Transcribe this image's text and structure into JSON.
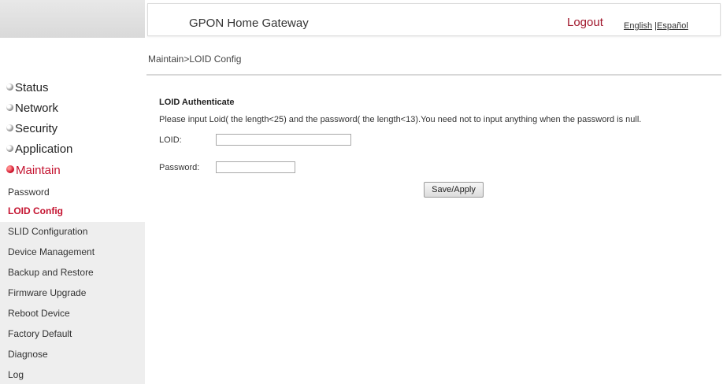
{
  "header": {
    "title": "GPON Home Gateway",
    "logout": "Logout",
    "lang_english": "English",
    "lang_sep": " |",
    "lang_spanish": "Español"
  },
  "breadcrumb": "Maintain>LOID Config",
  "sidebar": {
    "menu": [
      {
        "label": "Status",
        "icon": "bullet-icon"
      },
      {
        "label": "Network",
        "icon": "bullet-icon"
      },
      {
        "label": "Security",
        "icon": "bullet-icon"
      },
      {
        "label": "Application",
        "icon": "bullet-icon"
      },
      {
        "label": "Maintain",
        "icon": "bullet-icon",
        "active": true
      }
    ],
    "submenu": [
      {
        "label": "Password"
      },
      {
        "label": "LOID Config",
        "active": true
      },
      {
        "label": "SLID Configuration"
      },
      {
        "label": "Device Management"
      },
      {
        "label": "Backup and Restore"
      },
      {
        "label": "Firmware Upgrade"
      },
      {
        "label": "Reboot Device"
      },
      {
        "label": "Factory Default"
      },
      {
        "label": "Diagnose"
      },
      {
        "label": "Log"
      }
    ]
  },
  "form": {
    "section_title": "LOID Authenticate",
    "instructions": "Please input Loid( the length<25) and the password( the length<13).You need not to input anything when the password is null.",
    "loid_label": "LOID:",
    "loid_value": "",
    "password_label": "Password:",
    "password_value": "",
    "save_label": "Save/Apply"
  },
  "colors": {
    "accent": "#c4122f",
    "submenu_bg": "#eeeeee"
  }
}
